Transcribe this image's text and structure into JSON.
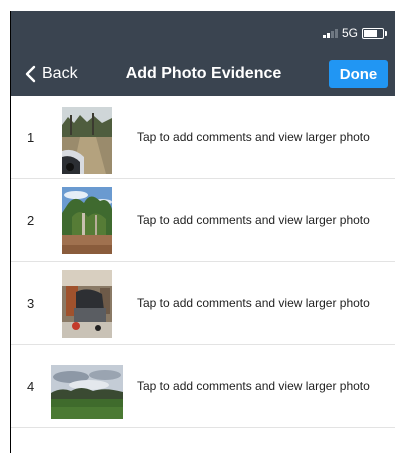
{
  "status_bar": {
    "network": "5G"
  },
  "nav": {
    "back_label": "Back",
    "title": "Add Photo Evidence",
    "done_label": "Done"
  },
  "photos": [
    {
      "index": "1",
      "caption": "Tap to add comments and view larger photo",
      "thumb": "photo-bush-track-vehicle"
    },
    {
      "index": "2",
      "caption": "Tap to add comments and view larger photo",
      "thumb": "photo-trees-sky"
    },
    {
      "index": "3",
      "caption": "Tap to add comments and view larger photo",
      "thumb": "photo-garage-equipment"
    },
    {
      "index": "4",
      "caption": "Tap to add comments and view larger photo",
      "thumb": "photo-paddock-landscape"
    }
  ],
  "colors": {
    "nav_bg": "#3a4450",
    "done_bg": "#2196f3",
    "divider": "#e3e3e3"
  }
}
